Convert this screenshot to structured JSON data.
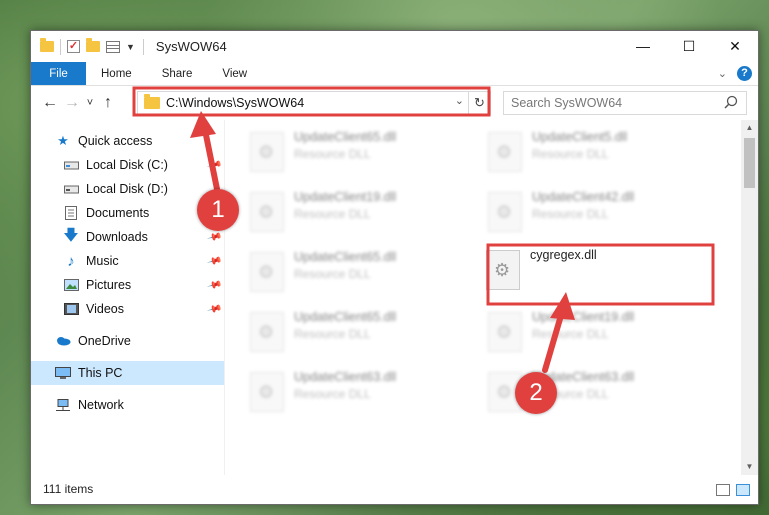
{
  "window": {
    "title": "SysWOW64",
    "controls": {
      "minimize": "—",
      "maximize": "☐",
      "close": "✕"
    }
  },
  "ribbon": {
    "tabs": [
      "File",
      "Home",
      "Share",
      "View"
    ],
    "expand_icon": "chevron-down-icon",
    "help_label": "?"
  },
  "nav": {
    "back": "←",
    "forward": "→",
    "recent": "˅",
    "up": "↑",
    "address": "C:\\Windows\\SysWOW64",
    "refresh": "↻",
    "search_placeholder": "Search SysWOW64"
  },
  "sidebar": {
    "quick_access": "Quick access",
    "items": [
      {
        "label": "Local Disk (C:)",
        "icon": "drive-icon",
        "pinned": true
      },
      {
        "label": "Local Disk (D:)",
        "icon": "drive-icon",
        "pinned": false
      },
      {
        "label": "Documents",
        "icon": "documents-icon",
        "pinned": true
      },
      {
        "label": "Downloads",
        "icon": "downloads-icon",
        "pinned": true
      },
      {
        "label": "Music",
        "icon": "music-icon",
        "pinned": true
      },
      {
        "label": "Pictures",
        "icon": "pictures-icon",
        "pinned": true
      },
      {
        "label": "Videos",
        "icon": "videos-icon",
        "pinned": true
      }
    ],
    "onedrive": "OneDrive",
    "this_pc": "This PC",
    "network": "Network"
  },
  "files": [
    {
      "name": "UpdateClient65.dll",
      "type": "Resource DLL"
    },
    {
      "name": "UpdateClient5.dll",
      "type": "Resource DLL"
    },
    {
      "name": "UpdateClient19.dll",
      "type": "Resource DLL"
    },
    {
      "name": "UpdateClient42.dll",
      "type": "Resource DLL"
    },
    {
      "name": "UpdateClient65.dll",
      "type": "Resource DLL"
    },
    {
      "name": "cygregex.dll",
      "type": ""
    },
    {
      "name": "UpdateClient65.dll",
      "type": "Resource DLL"
    },
    {
      "name": "UpdateClient19.dll",
      "type": "Resource DLL"
    },
    {
      "name": "UpdateClient63.dll",
      "type": "Resource DLL"
    },
    {
      "name": "UpdateClient63.dll",
      "type": "Resource DLL"
    }
  ],
  "status": {
    "item_count": "111 items"
  },
  "annotations": {
    "step1": "1",
    "step2": "2",
    "color": "#e0413f"
  }
}
